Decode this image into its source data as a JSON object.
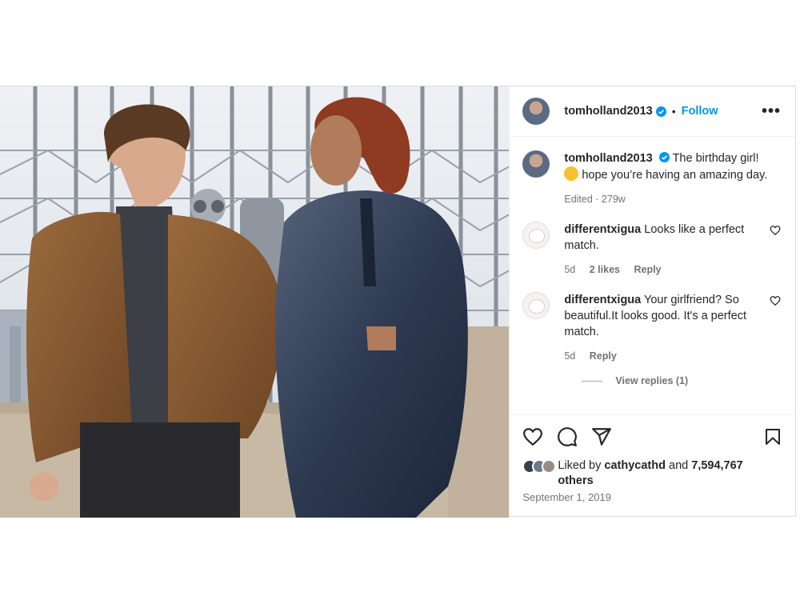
{
  "post": {
    "author": "tomholland2013",
    "separator": "•",
    "follow_label": "Follow",
    "more_label": "•••",
    "verified_color": "#0095f6"
  },
  "caption": {
    "author": "tomholland2013",
    "text_line1": "The birthday girl!",
    "text_rest": "hope you’re having an amazing day.",
    "meta": "Edited · 279w"
  },
  "comments": [
    {
      "author": "differentxigua",
      "text": "Looks like a perfect match.",
      "age": "5d",
      "likes": "2 likes",
      "reply_label": "Reply"
    },
    {
      "author": "differentxigua",
      "text": "Your girlfriend? So beautiful.It looks good. It's a perfect match.",
      "age": "5d",
      "reply_label": "Reply",
      "view_replies": "View replies (1)"
    }
  ],
  "engagement": {
    "liked_by_prefix": "Liked by",
    "liked_by_user": "cathycathd",
    "and": "and",
    "count": "7,594,767",
    "others": "others",
    "date": "September 1, 2019"
  },
  "icons": {
    "like": "heart-icon",
    "comment": "comment-icon",
    "share": "share-icon",
    "save": "bookmark-icon",
    "emoji": "smiling-face-with-heart-eyes-emoji"
  }
}
